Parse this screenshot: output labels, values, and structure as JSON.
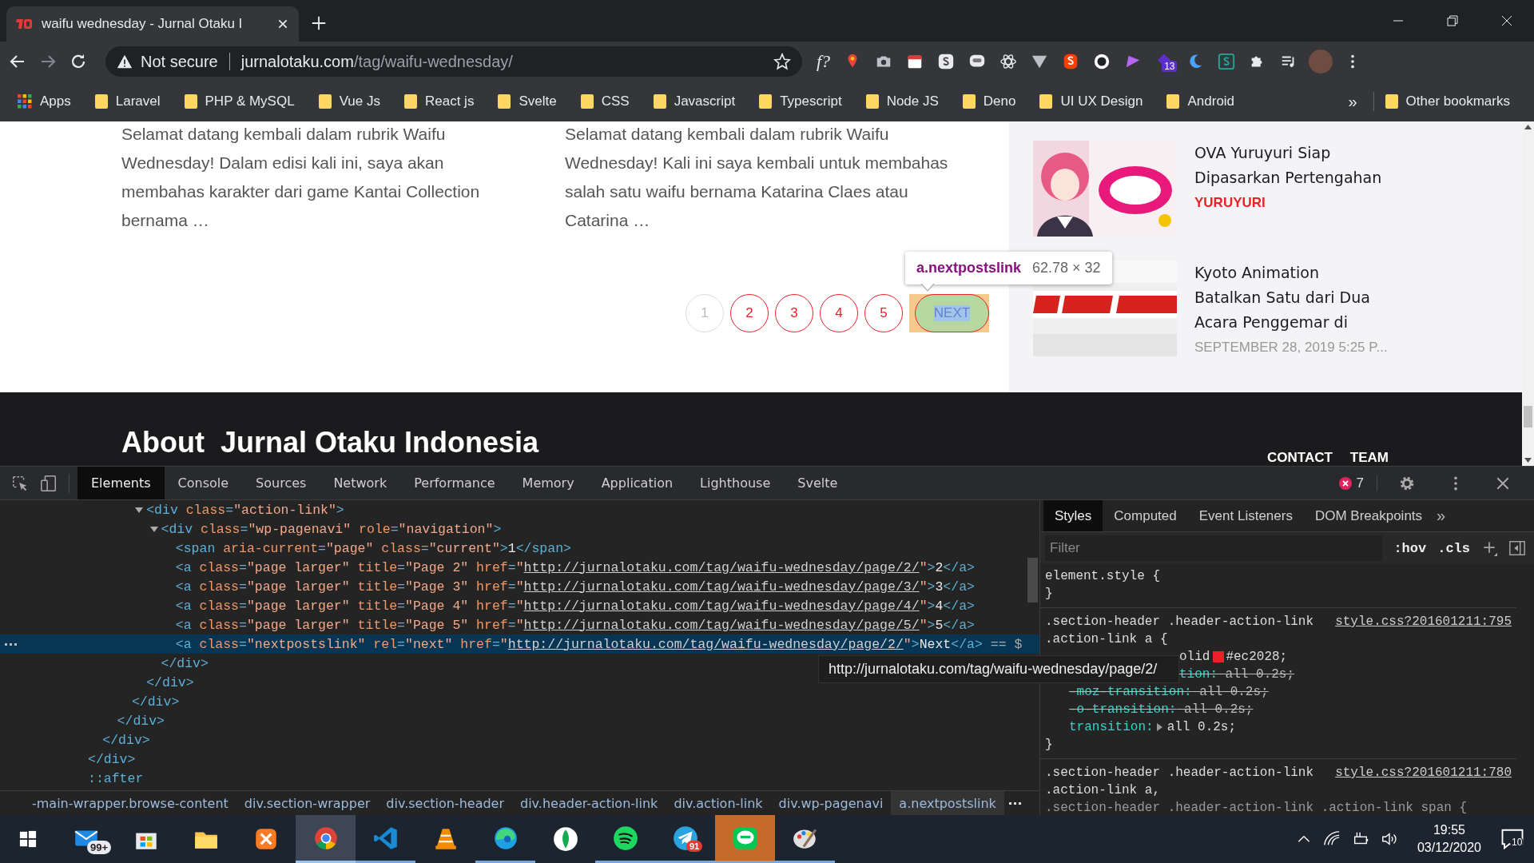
{
  "browser": {
    "tab": {
      "title": "waifu wednesday - Jurnal Otaku I"
    },
    "security": "Not secure",
    "url_host": "jurnalotaku.com",
    "url_path": "/tag/waifu-wednesday/",
    "extensions": [
      {
        "kind": "text",
        "label": "f?"
      },
      {
        "kind": "pin"
      },
      {
        "kind": "camera"
      },
      {
        "kind": "calendar"
      },
      {
        "kind": "tile"
      },
      {
        "kind": "chat"
      },
      {
        "kind": "atom"
      },
      {
        "kind": "vee"
      },
      {
        "kind": "shield"
      },
      {
        "kind": "dots"
      },
      {
        "kind": "wedge"
      },
      {
        "kind": "badge",
        "label": "13"
      },
      {
        "kind": "moon"
      },
      {
        "kind": "tile-green"
      },
      {
        "kind": "puzzle"
      },
      {
        "kind": "playlist"
      }
    ],
    "apps": "Apps",
    "bookmarks": [
      "Laravel",
      "PHP & MySQL",
      "Vue Js",
      "React js",
      "Svelte",
      "CSS",
      "Javascript",
      "Typescript",
      "Node JS",
      "Deno",
      "UI UX Design",
      "Android"
    ],
    "bookmarks_more": "»",
    "other_bookmarks": "Other bookmarks"
  },
  "page": {
    "excerpts": [
      "Selamat datang kembali dalam rubrik Waifu Wednesday! Dalam edisi kali ini, saya akan membahas karakter dari game Kantai Collection bernama …",
      "Selamat datang kembali dalam rubrik Waifu Wednesday! Kali ini saya kembali untuk membahas salah satu waifu bernama Katarina Claes atau Catarina …"
    ],
    "pagination": [
      {
        "label": "1",
        "selected": true
      },
      {
        "label": "2",
        "selected": false
      },
      {
        "label": "3",
        "selected": false
      },
      {
        "label": "4",
        "selected": false
      },
      {
        "label": "5",
        "selected": false
      }
    ],
    "next": {
      "label": "NEXT",
      "highlighted": true
    },
    "inspect_tooltip": {
      "selector": "a.nextpostslink",
      "size": "62.78 × 32"
    },
    "sidebar": [
      {
        "title": "OVA Yuruyuri Siap Dipasarkan Pertengahan",
        "meta": "YURUYURI",
        "kind": "category"
      },
      {
        "title": "Kyoto Animation Batalkan Satu dari Dua Acara Penggemar di",
        "meta": "SEPTEMBER 28, 2019 5:25 P...",
        "kind": "date"
      }
    ],
    "footer": {
      "heading": "About  Jurnal Otaku Indonesia",
      "links": [
        "CONTACT",
        "TEAM"
      ]
    }
  },
  "devtools": {
    "tabs": [
      {
        "label": "Elements",
        "selected": true
      },
      {
        "label": "Console",
        "selected": false
      },
      {
        "label": "Sources",
        "selected": false
      },
      {
        "label": "Network",
        "selected": false
      },
      {
        "label": "Performance",
        "selected": false
      },
      {
        "label": "Memory",
        "selected": false
      },
      {
        "label": "Application",
        "selected": false
      },
      {
        "label": "Lighthouse",
        "selected": false
      },
      {
        "label": "Svelte",
        "selected": false
      }
    ],
    "error_count": "7",
    "dom": [
      {
        "selected": false,
        "close": [
          {
            "kind": "tag",
            "text": "</div>"
          }
        ],
        "children": [
          {
            "selected": false,
            "close": [
              {
                "kind": "tag",
                "text": "</div>"
              }
            ],
            "children": [
              {
                "selected": false,
                "close": [
                  {
                    "kind": "tag",
                    "text": "</div>"
                  }
                ],
                "children": [
                  {
                    "selected": false,
                    "close": [
                      {
                        "kind": "tag",
                        "text": "</div>"
                      }
                    ],
                    "children": [
                      {
                        "selected": false,
                        "expanded": true,
                        "open": [
                          {
                            "kind": "tag",
                            "text": "<div"
                          },
                          {
                            "kind": "attr",
                            "text": " class"
                          },
                          {
                            "kind": "tag",
                            "text": "="
                          },
                          {
                            "kind": "value",
                            "text": "\"action-link\""
                          },
                          {
                            "kind": "tag",
                            "text": ">"
                          }
                        ],
                        "close": [
                          {
                            "kind": "tag",
                            "text": "</div>"
                          }
                        ],
                        "children": [
                          {
                            "selected": false,
                            "expanded": true,
                            "open": [
                              {
                                "kind": "tag",
                                "text": "<div"
                              },
                              {
                                "kind": "attr",
                                "text": " class"
                              },
                              {
                                "kind": "tag",
                                "text": "="
                              },
                              {
                                "kind": "value",
                                "text": "\"wp-pagenavi\""
                              },
                              {
                                "kind": "attr",
                                "text": " role"
                              },
                              {
                                "kind": "tag",
                                "text": "="
                              },
                              {
                                "kind": "value",
                                "text": "\"navigation\""
                              },
                              {
                                "kind": "tag",
                                "text": ">"
                              }
                            ],
                            "close": [
                              {
                                "kind": "tag",
                                "text": "</div>"
                              }
                            ],
                            "children": [
                              {
                                "selected": false,
                                "open": [
                                  {
                                    "kind": "tag",
                                    "text": "<span"
                                  },
                                  {
                                    "kind": "attr",
                                    "text": " aria-current"
                                  },
                                  {
                                    "kind": "tag",
                                    "text": "="
                                  },
                                  {
                                    "kind": "value",
                                    "text": "\"page\""
                                  },
                                  {
                                    "kind": "attr",
                                    "text": " class"
                                  },
                                  {
                                    "kind": "tag",
                                    "text": "="
                                  },
                                  {
                                    "kind": "value",
                                    "text": "\"current\""
                                  },
                                  {
                                    "kind": "tag",
                                    "text": ">"
                                  },
                                  {
                                    "kind": "text",
                                    "text": "1"
                                  },
                                  {
                                    "kind": "tag",
                                    "text": "</span>"
                                  }
                                ]
                              },
                              {
                                "selected": false,
                                "open": [
                                  {
                                    "kind": "tag",
                                    "text": "<a"
                                  },
                                  {
                                    "kind": "attr",
                                    "text": " class"
                                  },
                                  {
                                    "kind": "tag",
                                    "text": "="
                                  },
                                  {
                                    "kind": "value",
                                    "text": "\"page larger\""
                                  },
                                  {
                                    "kind": "attr",
                                    "text": " title"
                                  },
                                  {
                                    "kind": "tag",
                                    "text": "="
                                  },
                                  {
                                    "kind": "value",
                                    "text": "\"Page 2\""
                                  },
                                  {
                                    "kind": "attr",
                                    "text": " href"
                                  },
                                  {
                                    "kind": "tag",
                                    "text": "="
                                  },
                                  {
                                    "kind": "value",
                                    "text": "\""
                                  },
                                  {
                                    "kind": "link",
                                    "text": "http://jurnalotaku.com/tag/waifu-wednesday/page/2/"
                                  },
                                  {
                                    "kind": "value",
                                    "text": "\""
                                  },
                                  {
                                    "kind": "tag",
                                    "text": ">"
                                  },
                                  {
                                    "kind": "text",
                                    "text": "2"
                                  },
                                  {
                                    "kind": "tag",
                                    "text": "</a>"
                                  }
                                ]
                              },
                              {
                                "selected": false,
                                "open": [
                                  {
                                    "kind": "tag",
                                    "text": "<a"
                                  },
                                  {
                                    "kind": "attr",
                                    "text": " class"
                                  },
                                  {
                                    "kind": "tag",
                                    "text": "="
                                  },
                                  {
                                    "kind": "value",
                                    "text": "\"page larger\""
                                  },
                                  {
                                    "kind": "attr",
                                    "text": " title"
                                  },
                                  {
                                    "kind": "tag",
                                    "text": "="
                                  },
                                  {
                                    "kind": "value",
                                    "text": "\"Page 3\""
                                  },
                                  {
                                    "kind": "attr",
                                    "text": " href"
                                  },
                                  {
                                    "kind": "tag",
                                    "text": "="
                                  },
                                  {
                                    "kind": "value",
                                    "text": "\""
                                  },
                                  {
                                    "kind": "link",
                                    "text": "http://jurnalotaku.com/tag/waifu-wednesday/page/3/"
                                  },
                                  {
                                    "kind": "value",
                                    "text": "\""
                                  },
                                  {
                                    "kind": "tag",
                                    "text": ">"
                                  },
                                  {
                                    "kind": "text",
                                    "text": "3"
                                  },
                                  {
                                    "kind": "tag",
                                    "text": "</a>"
                                  }
                                ]
                              },
                              {
                                "selected": false,
                                "open": [
                                  {
                                    "kind": "tag",
                                    "text": "<a"
                                  },
                                  {
                                    "kind": "attr",
                                    "text": " class"
                                  },
                                  {
                                    "kind": "tag",
                                    "text": "="
                                  },
                                  {
                                    "kind": "value",
                                    "text": "\"page larger\""
                                  },
                                  {
                                    "kind": "attr",
                                    "text": " title"
                                  },
                                  {
                                    "kind": "tag",
                                    "text": "="
                                  },
                                  {
                                    "kind": "value",
                                    "text": "\"Page 4\""
                                  },
                                  {
                                    "kind": "attr",
                                    "text": " href"
                                  },
                                  {
                                    "kind": "tag",
                                    "text": "="
                                  },
                                  {
                                    "kind": "value",
                                    "text": "\""
                                  },
                                  {
                                    "kind": "link",
                                    "text": "http://jurnalotaku.com/tag/waifu-wednesday/page/4/"
                                  },
                                  {
                                    "kind": "value",
                                    "text": "\""
                                  },
                                  {
                                    "kind": "tag",
                                    "text": ">"
                                  },
                                  {
                                    "kind": "text",
                                    "text": "4"
                                  },
                                  {
                                    "kind": "tag",
                                    "text": "</a>"
                                  }
                                ]
                              },
                              {
                                "selected": false,
                                "open": [
                                  {
                                    "kind": "tag",
                                    "text": "<a"
                                  },
                                  {
                                    "kind": "attr",
                                    "text": " class"
                                  },
                                  {
                                    "kind": "tag",
                                    "text": "="
                                  },
                                  {
                                    "kind": "value",
                                    "text": "\"page larger\""
                                  },
                                  {
                                    "kind": "attr",
                                    "text": " title"
                                  },
                                  {
                                    "kind": "tag",
                                    "text": "="
                                  },
                                  {
                                    "kind": "value",
                                    "text": "\"Page 5\""
                                  },
                                  {
                                    "kind": "attr",
                                    "text": " href"
                                  },
                                  {
                                    "kind": "tag",
                                    "text": "="
                                  },
                                  {
                                    "kind": "value",
                                    "text": "\""
                                  },
                                  {
                                    "kind": "link",
                                    "text": "http://jurnalotaku.com/tag/waifu-wednesday/page/5/"
                                  },
                                  {
                                    "kind": "value",
                                    "text": "\""
                                  },
                                  {
                                    "kind": "tag",
                                    "text": ">"
                                  },
                                  {
                                    "kind": "text",
                                    "text": "5"
                                  },
                                  {
                                    "kind": "tag",
                                    "text": "</a>"
                                  }
                                ]
                              },
                              {
                                "selected": true,
                                "open": [
                                  {
                                    "kind": "tag",
                                    "text": "<a"
                                  },
                                  {
                                    "kind": "attr",
                                    "text": " class"
                                  },
                                  {
                                    "kind": "tag",
                                    "text": "="
                                  },
                                  {
                                    "kind": "value",
                                    "text": "\"nextpostslink\""
                                  },
                                  {
                                    "kind": "attr",
                                    "text": " rel"
                                  },
                                  {
                                    "kind": "tag",
                                    "text": "="
                                  },
                                  {
                                    "kind": "value",
                                    "text": "\"next\""
                                  },
                                  {
                                    "kind": "attr",
                                    "text": " href"
                                  },
                                  {
                                    "kind": "tag",
                                    "text": "="
                                  },
                                  {
                                    "kind": "value",
                                    "text": "\""
                                  },
                                  {
                                    "kind": "link",
                                    "text": "http://jurnalotaku.com/tag/waifu-wednesday/page/2/"
                                  },
                                  {
                                    "kind": "value",
                                    "text": "\""
                                  },
                                  {
                                    "kind": "tag",
                                    "text": ">"
                                  },
                                  {
                                    "kind": "text",
                                    "text": "Next"
                                  },
                                  {
                                    "kind": "tag",
                                    "text": "</a>"
                                  },
                                  {
                                    "kind": "hint",
                                    "text": " == $"
                                  }
                                ]
                              }
                            ]
                          }
                        ]
                      }
                    ]
                  }
                ]
              }
            ]
          }
        ]
      },
      {
        "selected": false,
        "open": [
          {
            "kind": "tag",
            "text": "::after"
          }
        ]
      }
    ],
    "link_tooltip": "http://jurnalotaku.com/tag/waifu-wednesday/page/2/",
    "side_tabs": [
      {
        "label": "Styles",
        "selected": true
      },
      {
        "label": "Computed",
        "selected": false
      },
      {
        "label": "Event Listeners",
        "selected": false
      },
      {
        "label": "DOM Breakpoints",
        "selected": false
      }
    ],
    "side_more": "»",
    "filter_placeholder": "Filter",
    "hov": ":hov",
    "cls": ".cls",
    "rules": [
      {
        "selector": "element.style {",
        "close": "}"
      },
      {
        "selector": ".section-header .header-action-link .action-link a {",
        "source": "style.css?201601211:795",
        "close": "}",
        "declarations": [
          {
            "value": "olid",
            "color": "#ec2028",
            "value_after": "#ec2028;",
            "struck": false,
            "covered": true
          },
          {
            "prop": "tion:",
            "value": " all 0.2s;",
            "struck": true,
            "covered": true
          },
          {
            "prop": "-moz-transition:",
            "value": " all 0.2s;",
            "struck": true,
            "covered": false
          },
          {
            "prop": "-o-transition:",
            "value": " all 0.2s;",
            "struck": true,
            "covered": false
          },
          {
            "prop": "transition:",
            "value": "all 0.2s;",
            "expandable": true,
            "struck": false,
            "covered": false
          }
        ]
      },
      {
        "selector": ".section-header .header-action-link .action-link a,",
        "selector_rest": ".section-header .header-action-link .action-link span {",
        "source": "style.css?201601211:780"
      }
    ],
    "breadcrumbs": [
      {
        "label": "-main-wrapper.browse-content",
        "selected": false
      },
      {
        "label": "div.section-wrapper",
        "selected": false
      },
      {
        "label": "div.section-header",
        "selected": false
      },
      {
        "label": "div.header-action-link",
        "selected": false
      },
      {
        "label": "div.action-link",
        "selected": false
      },
      {
        "label": "div.wp-pagenavi",
        "selected": false
      },
      {
        "label": "a.nextpostslink",
        "selected": true
      }
    ]
  },
  "taskbar": {
    "apps": [
      {
        "kind": "mail",
        "badge": "99+",
        "running": false,
        "selected": false,
        "flashing": false
      },
      {
        "kind": "store",
        "running": false,
        "selected": false,
        "flashing": false
      },
      {
        "kind": "folder",
        "running": false,
        "selected": false,
        "flashing": false
      },
      {
        "kind": "xampp",
        "running": false,
        "selected": false,
        "flashing": false
      },
      {
        "kind": "chrome",
        "running": true,
        "selected": true,
        "flashing": false
      },
      {
        "kind": "vscode",
        "running": true,
        "selected": false,
        "flashing": false
      },
      {
        "kind": "vlc",
        "running": false,
        "selected": false,
        "flashing": false
      },
      {
        "kind": "edge",
        "running": true,
        "selected": false,
        "flashing": false
      },
      {
        "kind": "leaf",
        "running": false,
        "selected": false,
        "flashing": false
      },
      {
        "kind": "spotify",
        "running": true,
        "selected": false,
        "flashing": false
      },
      {
        "kind": "telegram",
        "badge": "91",
        "running": true,
        "selected": false,
        "flashing": false
      },
      {
        "kind": "line",
        "running": true,
        "selected": false,
        "flashing": true
      },
      {
        "kind": "paint",
        "running": true,
        "selected": false,
        "flashing": false
      }
    ],
    "time": "19:55",
    "date": "03/12/2020",
    "notification_count": "10"
  }
}
